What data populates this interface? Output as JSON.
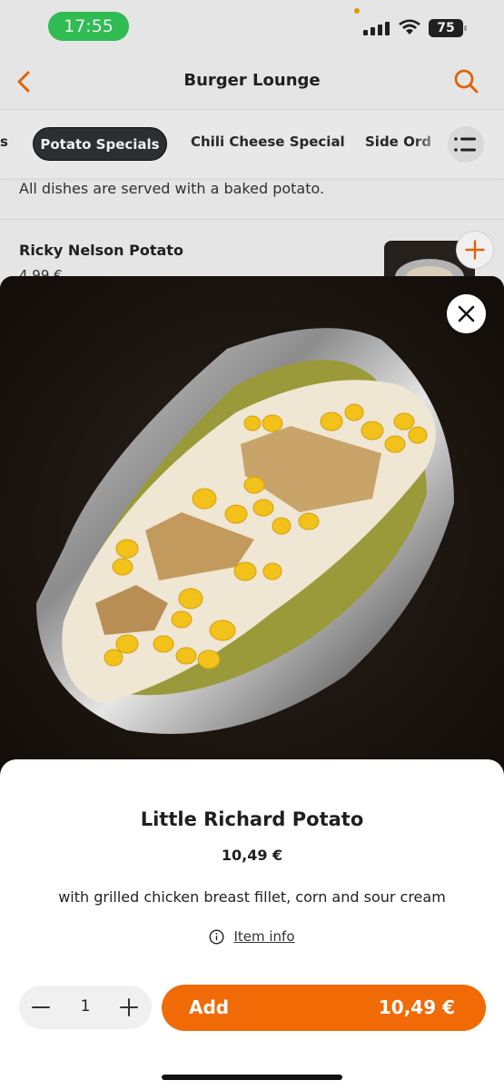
{
  "status_bar": {
    "time": "17:55",
    "battery": "75"
  },
  "header": {
    "title": "Burger Lounge"
  },
  "categories": {
    "partial_left": "s",
    "active": "Potato Specials",
    "items": [
      "Chili Cheese Special",
      "Side Ord"
    ]
  },
  "section": {
    "description": "All dishes are served with a baked potato."
  },
  "background_item": {
    "name": "Ricky Nelson Potato",
    "price": "4,99 €"
  },
  "modal": {
    "title": "Little Richard Potato",
    "price": "10,49 €",
    "description": "with grilled chicken breast fillet, corn and sour cream",
    "info_link": "Item info",
    "quantity": "1",
    "add_label": "Add",
    "add_total": "10,49 €"
  },
  "colors": {
    "accent": "#f06a06",
    "active_chip": "#2e3235",
    "time_pill": "#34c759"
  }
}
